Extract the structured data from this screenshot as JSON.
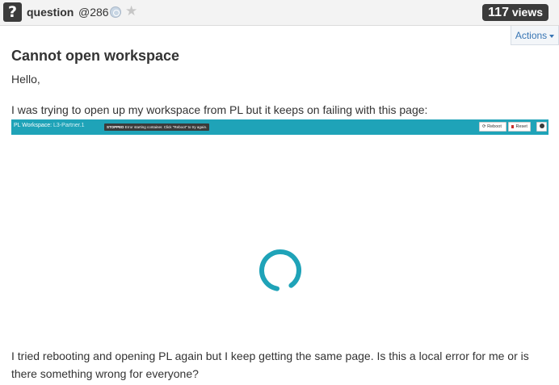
{
  "header": {
    "post_type": "question",
    "post_number": "@286",
    "views_count": "117",
    "views_label": "views"
  },
  "actions": {
    "label": "Actions"
  },
  "post": {
    "title": "Cannot open workspace",
    "greeting": "Hello,",
    "paragraph1": "I was trying to open up my workspace from PL but it keeps on failing with this page:",
    "paragraph2": "I tried rebooting and opening PL again but I keep getting the same page. Is this a local error for me or is there something wrong for everyone?"
  },
  "screenshot": {
    "title": "PL Workspace:",
    "subtitle": "L3-Partner.1",
    "status_badge": "STOPPED",
    "status_message": "Error starting container. Click \"Reboot\" to try again.",
    "reboot_label": "Reboot",
    "reset_label": "Reset",
    "bar_color": "#1fa3b8"
  },
  "icons": [
    "question-icon",
    "watch-icon",
    "star-icon",
    "caret-down-icon",
    "refresh-icon",
    "trash-icon",
    "help-icon",
    "loading-spinner-icon"
  ]
}
